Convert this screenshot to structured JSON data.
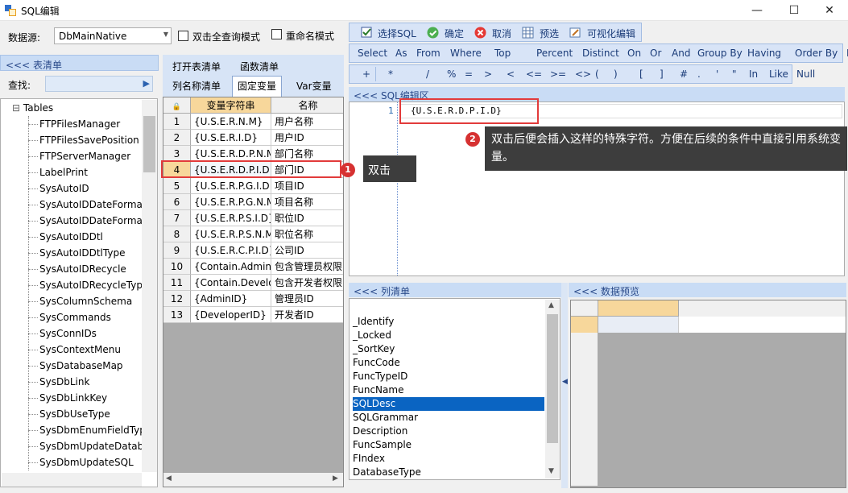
{
  "window": {
    "title": "SQL编辑",
    "min": "—",
    "max": "☐",
    "close": "✕"
  },
  "datasource": {
    "label": "数据源:",
    "value": "DbMainNative"
  },
  "options": {
    "dblclick_query": "双击全查询模式",
    "rename_mode": "重命名模式"
  },
  "left": {
    "header": "<<< 表清单",
    "search_label": "查找:",
    "root": "Tables",
    "items": [
      "FTPFilesManager",
      "FTPFilesSavePosition",
      "FTPServerManager",
      "LabelPrint",
      "SysAutoID",
      "SysAutoIDDateFormat",
      "SysAutoIDDateFormat",
      "SysAutoIDDtl",
      "SysAutoIDDtlType",
      "SysAutoIDRecycle",
      "SysAutoIDRecycleType",
      "SysColumnSchema",
      "SysCommands",
      "SysConnIDs",
      "SysContextMenu",
      "SysDatabaseMap",
      "SysDbLink",
      "SysDbLinkKey",
      "SysDbUseType",
      "SysDbmEnumFieldTyp",
      "SysDbmUpdateDataba",
      "SysDbmUpdateSQL"
    ]
  },
  "mid": {
    "tabs": [
      "打开表清单",
      "函数清单",
      "列名称清单",
      "固定变量",
      "Var变量"
    ],
    "grid_headers": [
      "变量字符串",
      "名称"
    ],
    "rows": [
      [
        "1",
        "{U.S.E.R.N.M}",
        "用户名称"
      ],
      [
        "2",
        "{U.S.E.R.I.D}",
        "用户ID"
      ],
      [
        "3",
        "{U.S.E.R.D.P.N.M",
        "部门名称"
      ],
      [
        "4",
        "{U.S.E.R.D.P.I.D}",
        "部门ID"
      ],
      [
        "5",
        "{U.S.E.R.P.G.I.D}",
        "项目ID"
      ],
      [
        "6",
        "{U.S.E.R.P.G.N.M",
        "项目名称"
      ],
      [
        "7",
        "{U.S.E.R.P.S.I.D}",
        "职位ID"
      ],
      [
        "8",
        "{U.S.E.R.P.S.N.M}",
        "职位名称"
      ],
      [
        "9",
        "{U.S.E.R.C.P.I.D}",
        "公司ID"
      ],
      [
        "10",
        "{Contain.Admin}",
        "包含管理员权限"
      ],
      [
        "11",
        "{Contain.Develop",
        "包含开发者权限"
      ],
      [
        "12",
        "{AdminID}",
        "管理员ID"
      ],
      [
        "13",
        "{DeveloperID}",
        "开发者ID"
      ]
    ]
  },
  "annotations": {
    "b1": "1",
    "n1": "双击",
    "b2": "2",
    "n2": "双击后便会插入这样的特殊字符。方便在后续的条件中直接引用系统变量。"
  },
  "toolbar1": [
    "选择SQL",
    "确定",
    "取消",
    "预选",
    "可视化编辑"
  ],
  "toolbar2": [
    "Select",
    "As",
    "From",
    "Where",
    "Top",
    "Percent",
    "Distinct",
    "On",
    "Or",
    "And",
    "Group By",
    "Having",
    "Order By",
    "Desc"
  ],
  "toolbar3": [
    "+",
    "*",
    "/",
    "%",
    "=",
    ">",
    "<",
    "<=",
    ">=",
    "<>",
    "(",
    ")",
    "[",
    "]",
    "#",
    ".",
    "'",
    "\"",
    "In",
    "Like",
    "Null"
  ],
  "sql": {
    "header": "<<< SQL编辑区",
    "line": "1",
    "text": "{U.S.E.R.D.P.I.D}"
  },
  "columns": {
    "header": "<<< 列清单",
    "items": [
      "_Identify",
      "_Locked",
      "_SortKey",
      "FuncCode",
      "FuncTypeID",
      "FuncName",
      "SQLDesc",
      "SQLGrammar",
      "Description",
      "FuncSample",
      "FIndex",
      "DatabaseType"
    ],
    "selected": "SQLDesc"
  },
  "preview": {
    "header": "<<< 数据预览"
  }
}
